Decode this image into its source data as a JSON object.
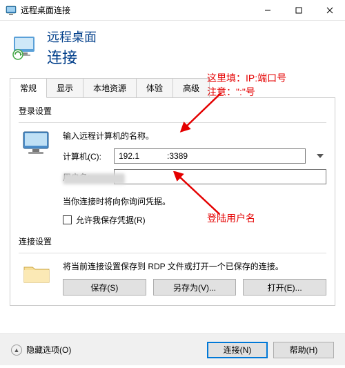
{
  "window": {
    "title": "远程桌面连接"
  },
  "header": {
    "line1": "远程桌面",
    "line2": "连接"
  },
  "tabs": [
    "常规",
    "显示",
    "本地资源",
    "体验",
    "高级"
  ],
  "login_group": {
    "title": "登录设置",
    "intro": "输入远程计算机的名称。",
    "computer_label": "计算机(C):",
    "computer_value": "192.1            :3389",
    "username_label": "用户名:",
    "username_value": "",
    "note": "当你连接时将向你询问凭据。",
    "checkbox_label": "允许我保存凭据(R)"
  },
  "conn_group": {
    "title": "连接设置",
    "intro": "将当前连接设置保存到 RDP 文件或打开一个已保存的连接。",
    "save": "保存(S)",
    "save_as": "另存为(V)...",
    "open": "打开(E)..."
  },
  "bottom": {
    "hide_options": "隐藏选项(O)",
    "connect": "连接(N)",
    "help": "帮助(H)"
  },
  "annotations": {
    "ann1_line1": "这里填：IP:端口号",
    "ann1_line2": "注意：\":\"号",
    "ann2": "登陆用户名"
  }
}
